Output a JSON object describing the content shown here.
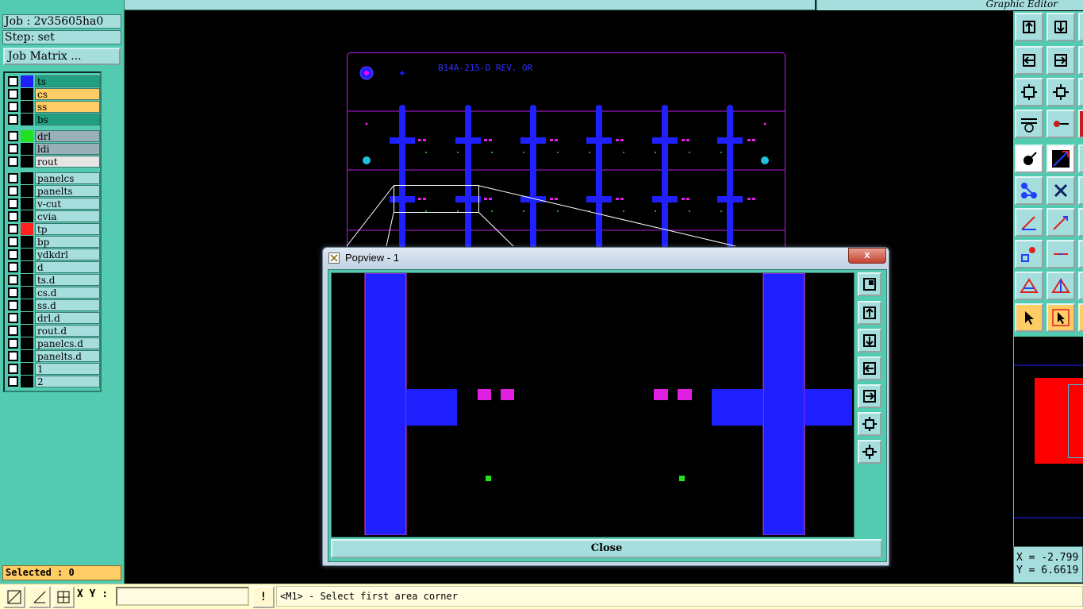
{
  "left_panel": {
    "job_label": "Job : 2v35605ha0",
    "step_label": "Step: set",
    "job_matrix_button": "Job Matrix ...",
    "layers": [
      {
        "name": "ts",
        "swatch": "#2020ff",
        "bg": "#20a080"
      },
      {
        "name": "cs",
        "swatch": "#000000",
        "bg": "#ffcc66"
      },
      {
        "name": "ss",
        "swatch": "#000000",
        "bg": "#ffcc66"
      },
      {
        "name": "bs",
        "swatch": "#000000",
        "bg": "#20a080"
      },
      {
        "name": "drl",
        "swatch": "#20e020",
        "bg": "#9ab0b8"
      },
      {
        "name": "ldi",
        "swatch": "#000000",
        "bg": "#9ab0b8"
      },
      {
        "name": "rout",
        "swatch": "#000000",
        "bg": "#e6e6e6"
      },
      {
        "name": "panelcs",
        "swatch": "#000000",
        "bg": "#a6dede"
      },
      {
        "name": "panelts",
        "swatch": "#000000",
        "bg": "#a6dede"
      },
      {
        "name": "v-cut",
        "swatch": "#000000",
        "bg": "#a6dede"
      },
      {
        "name": "cvia",
        "swatch": "#000000",
        "bg": "#a6dede"
      },
      {
        "name": "tp",
        "swatch": "#ff2020",
        "bg": "#a6dede"
      },
      {
        "name": "bp",
        "swatch": "#000000",
        "bg": "#a6dede"
      },
      {
        "name": "ydkdrl",
        "swatch": "#000000",
        "bg": "#a6dede"
      },
      {
        "name": "d",
        "swatch": "#000000",
        "bg": "#a6dede"
      },
      {
        "name": "ts.d",
        "swatch": "#000000",
        "bg": "#a6dede"
      },
      {
        "name": "cs.d",
        "swatch": "#000000",
        "bg": "#a6dede"
      },
      {
        "name": "ss.d",
        "swatch": "#000000",
        "bg": "#a6dede"
      },
      {
        "name": "drl.d",
        "swatch": "#000000",
        "bg": "#a6dede"
      },
      {
        "name": "rout.d",
        "swatch": "#000000",
        "bg": "#a6dede"
      },
      {
        "name": "panelcs.d",
        "swatch": "#000000",
        "bg": "#a6dede"
      },
      {
        "name": "panelts.d",
        "swatch": "#000000",
        "bg": "#a6dede"
      },
      {
        "name": "1",
        "swatch": "#000000",
        "bg": "#a6dede"
      },
      {
        "name": "2",
        "swatch": "#000000",
        "bg": "#a6dede"
      }
    ],
    "selected_label": "Selected : 0"
  },
  "header": {
    "editor_title": "Graphic Editor"
  },
  "canvas": {
    "board_text": "B14A-215-D REV. OR"
  },
  "coords": {
    "x": "X = -2.799",
    "y": "Y = 6.6619"
  },
  "bottom": {
    "xy_label": "X Y :",
    "xy_value": "",
    "alert_icon": "!",
    "message": "<M1> - Select first area corner"
  },
  "popview": {
    "title": "Popview - 1",
    "close_x": "x",
    "close_button": "Close"
  },
  "colors": {
    "teal": "#52cbb0",
    "light": "#a6dede",
    "trace_blue": "#2020ff",
    "pad_magenta": "#e020e0",
    "drill_green": "#20e020"
  }
}
